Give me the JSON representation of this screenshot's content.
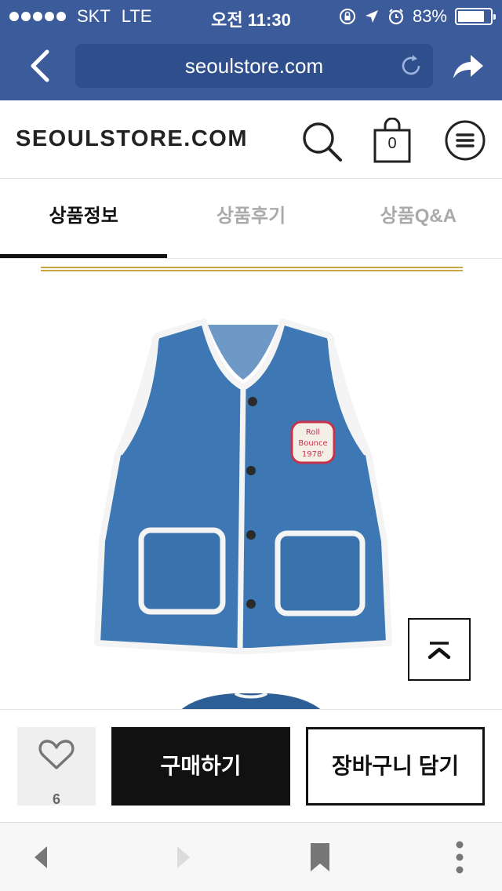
{
  "status_bar": {
    "carrier": "SKT",
    "network": "LTE",
    "time": "오전 11:30",
    "battery_percent_text": "83%",
    "battery_level": 0.83
  },
  "browser": {
    "url": "seoulstore.com"
  },
  "site": {
    "logo": "SEOULSTORE.COM",
    "cart_count": "0"
  },
  "tabs": [
    {
      "label": "상품정보",
      "active": true
    },
    {
      "label": "상품후기",
      "active": false
    },
    {
      "label": "상품Q&A",
      "active": false
    }
  ],
  "product_image": {
    "patch_text_line1": "Roll",
    "patch_text_line2": "Bounce",
    "patch_text_line3": "1978'"
  },
  "actions": {
    "like_count": "6",
    "buy_label": "구매하기",
    "add_to_cart_label": "장바구니 담기"
  },
  "colors": {
    "browser_bar": "#3b5b9a",
    "accent_gold": "#c9a640",
    "button_dark": "#111111",
    "denim": "#3d78b4"
  }
}
